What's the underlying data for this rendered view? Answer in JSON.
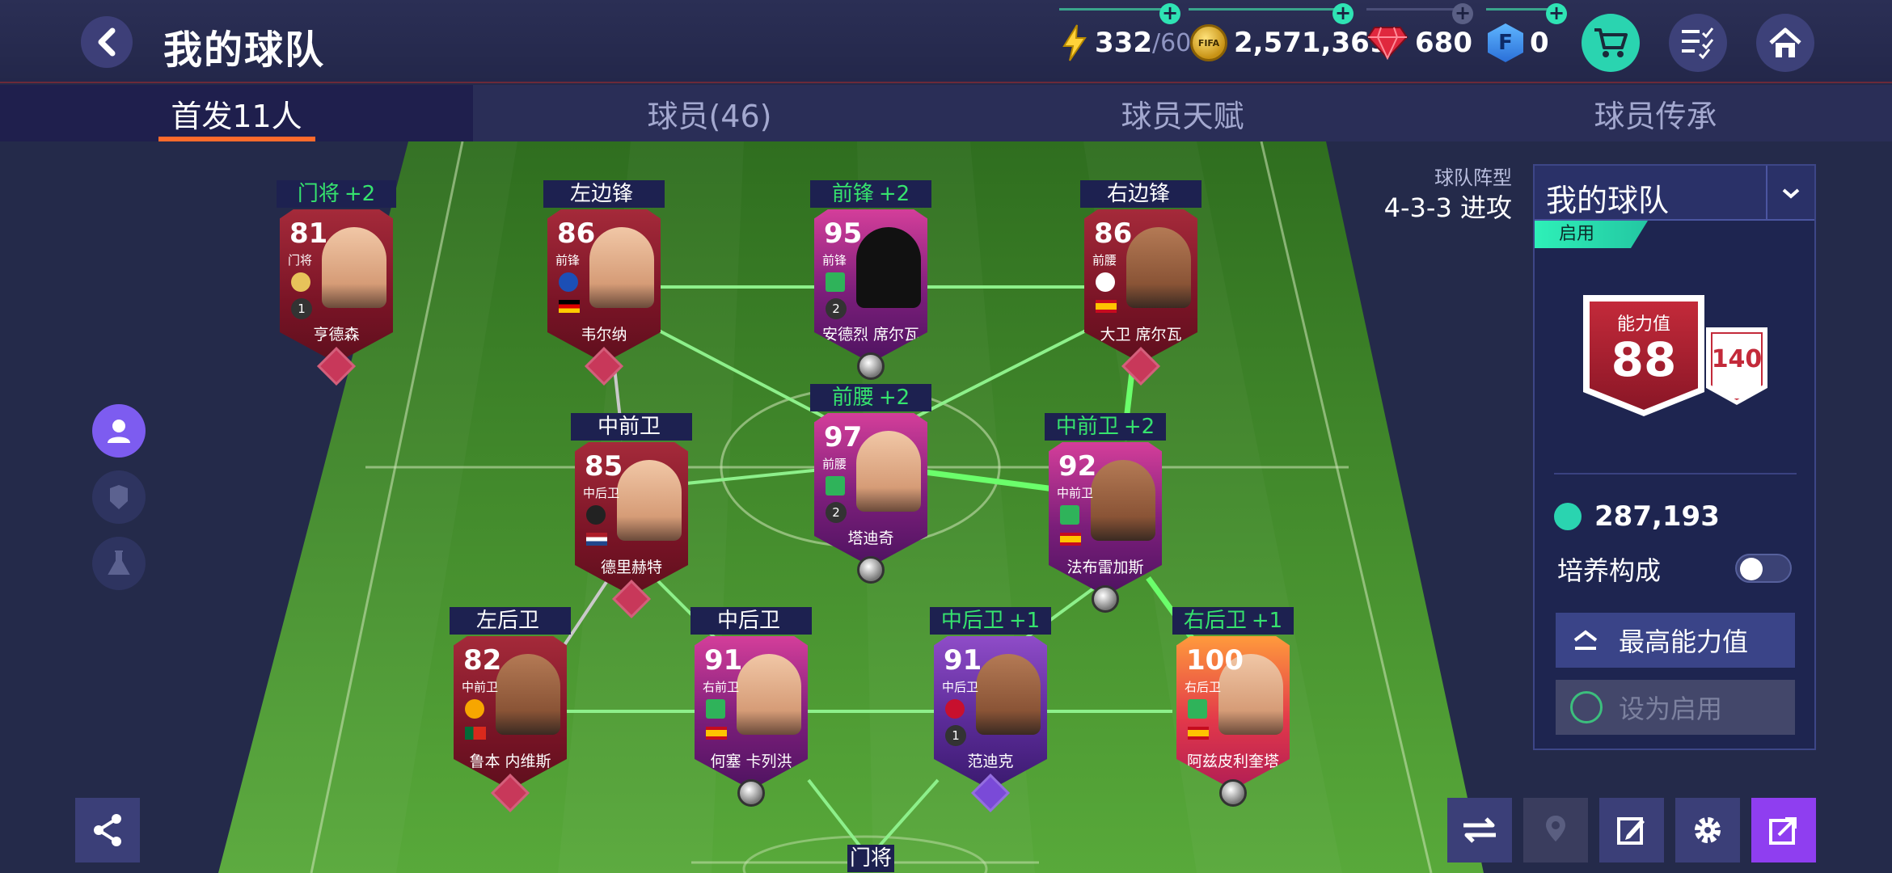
{
  "header": {
    "title": "我的球队",
    "energy": {
      "current": "332",
      "max": "/60"
    },
    "coins": "2,571,369",
    "coin_label": "FIFA",
    "gems": "680",
    "fifa_points": "0",
    "fifa_points_label": "F"
  },
  "tabs": [
    "首发11人",
    "球员(46)",
    "球员天赋",
    "球员传承"
  ],
  "formation": {
    "label": "球队阵型",
    "value": "4-3-3 进攻"
  },
  "squad_panel": {
    "name": "我的球队",
    "status_tag": "启用",
    "ovr_caption": "能力值",
    "ovr": "88",
    "chemistry": "140",
    "team_value": "287,193",
    "toggle_label": "培养构成",
    "toggle_on": false,
    "btn_max": "最高能力值",
    "btn_activate": "设为启用"
  },
  "players": [
    {
      "slot": "门将",
      "bonus": "+2",
      "rating": "81",
      "pos": "门将",
      "name": "亨德森",
      "style": "red",
      "lvl": "1"
    },
    {
      "slot": "左边锋",
      "bonus": "",
      "rating": "86",
      "pos": "前锋",
      "name": "韦尔纳",
      "style": "red",
      "lvl": ""
    },
    {
      "slot": "前锋",
      "bonus": "+2",
      "rating": "95",
      "pos": "前锋",
      "name": "安德烈 席尔瓦",
      "style": "pink",
      "lvl": "2"
    },
    {
      "slot": "右边锋",
      "bonus": "",
      "rating": "86",
      "pos": "前腰",
      "name": "大卫 席尔瓦",
      "style": "red",
      "lvl": ""
    },
    {
      "slot": "中前卫",
      "bonus": "",
      "rating": "85",
      "pos": "中后卫",
      "name": "德里赫特",
      "style": "red",
      "lvl": ""
    },
    {
      "slot": "前腰",
      "bonus": "+2",
      "rating": "97",
      "pos": "前腰",
      "name": "塔迪奇",
      "style": "pink",
      "lvl": "2"
    },
    {
      "slot": "中前卫",
      "bonus": "+2",
      "rating": "92",
      "pos": "中前卫",
      "name": "法布雷加斯",
      "style": "pink",
      "lvl": ""
    },
    {
      "slot": "左后卫",
      "bonus": "",
      "rating": "82",
      "pos": "中前卫",
      "name": "鲁本 内维斯",
      "style": "red",
      "lvl": ""
    },
    {
      "slot": "中后卫",
      "bonus": "",
      "rating": "91",
      "pos": "右前卫",
      "name": "何塞 卡列洪",
      "style": "pink",
      "lvl": ""
    },
    {
      "slot": "中后卫",
      "bonus": "+1",
      "rating": "91",
      "pos": "中后卫",
      "name": "范迪克",
      "style": "purple",
      "lvl": "1"
    },
    {
      "slot": "右后卫",
      "bonus": "+1",
      "rating": "100",
      "pos": "右后卫",
      "name": "阿兹皮利奎塔",
      "style": "fire",
      "lvl": ""
    }
  ],
  "bottom_label": "门将",
  "colors": {
    "accent": "#2ad4b0",
    "tab_underline": "#ff6a2c",
    "bonus": "#36e36e",
    "pitch": "#3f8a2a"
  }
}
